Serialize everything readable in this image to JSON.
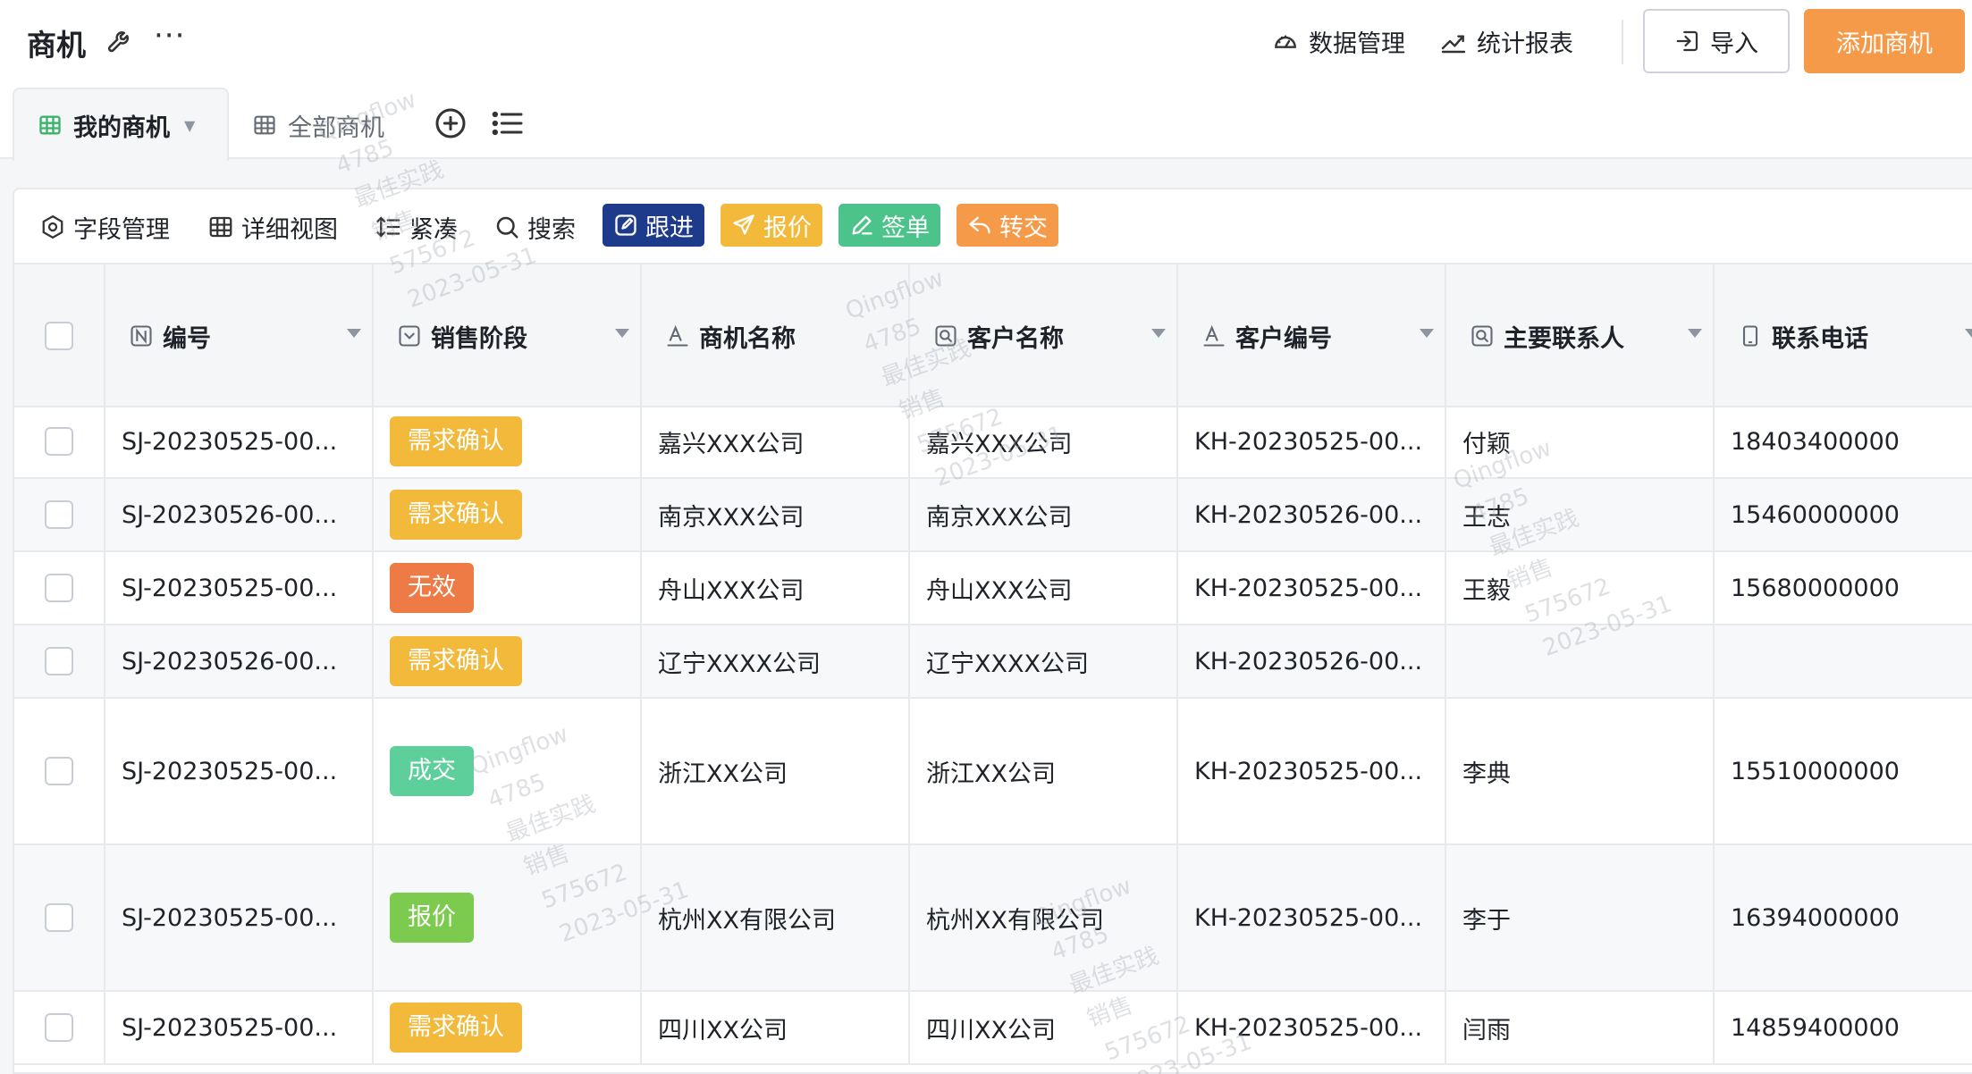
{
  "header": {
    "title": "商机",
    "links": [
      {
        "label": "数据管理",
        "icon": "dashboard-icon"
      },
      {
        "label": "统计报表",
        "icon": "line-chart-icon"
      }
    ],
    "import_label": "导入",
    "add_label": "添加商机",
    "accent": "#f59a48"
  },
  "tabs": {
    "active": "我的商机",
    "inactive": "全部商机"
  },
  "toolbar": {
    "tools": [
      "字段管理",
      "详细视图",
      "紧凑",
      "搜索"
    ],
    "actions": [
      {
        "label": "跟进",
        "color": "#1e3a8a"
      },
      {
        "label": "报价",
        "color": "#f2b93b"
      },
      {
        "label": "签单",
        "color": "#4cc38a"
      },
      {
        "label": "转交",
        "color": "#f59a48"
      }
    ]
  },
  "table": {
    "columns": [
      "编号",
      "销售阶段",
      "商机名称",
      "客户名称",
      "客户编号",
      "主要联系人",
      "联系电话"
    ],
    "rows": [
      {
        "id": "SJ-20230525-00...",
        "stage": "需求确认",
        "stage_color": "#f2b93b",
        "name": "嘉兴XXX公司",
        "customer": "嘉兴XXX公司",
        "customer_id": "KH-20230525-00...",
        "contact": "付颖",
        "phone": "18403400000"
      },
      {
        "id": "SJ-20230526-00...",
        "stage": "需求确认",
        "stage_color": "#f2b93b",
        "name": "南京XXX公司",
        "customer": "南京XXX公司",
        "customer_id": "KH-20230526-00...",
        "contact": "王志",
        "phone": "15460000000"
      },
      {
        "id": "SJ-20230525-00...",
        "stage": "无效",
        "stage_color": "#ee7b45",
        "name": "舟山XXX公司",
        "customer": "舟山XXX公司",
        "customer_id": "KH-20230525-00...",
        "contact": "王毅",
        "phone": "15680000000"
      },
      {
        "id": "SJ-20230526-00...",
        "stage": "需求确认",
        "stage_color": "#f2b93b",
        "name": "辽宁XXXX公司",
        "customer": "辽宁XXXX公司",
        "customer_id": "KH-20230526-00...",
        "contact": "",
        "phone": ""
      },
      {
        "id": "SJ-20230525-00...",
        "stage": "成交",
        "stage_color": "#5ccf9a",
        "name": "浙江XX公司",
        "customer": "浙江XX公司",
        "customer_id": "KH-20230525-00...",
        "contact": "李典",
        "phone": "15510000000"
      },
      {
        "id": "SJ-20230525-00...",
        "stage": "报价",
        "stage_color": "#7ccb4e",
        "name": "杭州XX有限公司",
        "customer": "杭州XX有限公司",
        "customer_id": "KH-20230525-00...",
        "contact": "李于",
        "phone": "16394000000"
      },
      {
        "id": "SJ-20230525-00...",
        "stage": "需求确认",
        "stage_color": "#f2b93b",
        "name": "四川XX公司",
        "customer": "四川XX公司",
        "customer_id": "KH-20230525-00...",
        "contact": "闫雨",
        "phone": "14859400000"
      }
    ]
  },
  "watermark": [
    "Qingflow",
    "4785",
    "最佳实践",
    "销售",
    "575672",
    "2023-05-31"
  ]
}
